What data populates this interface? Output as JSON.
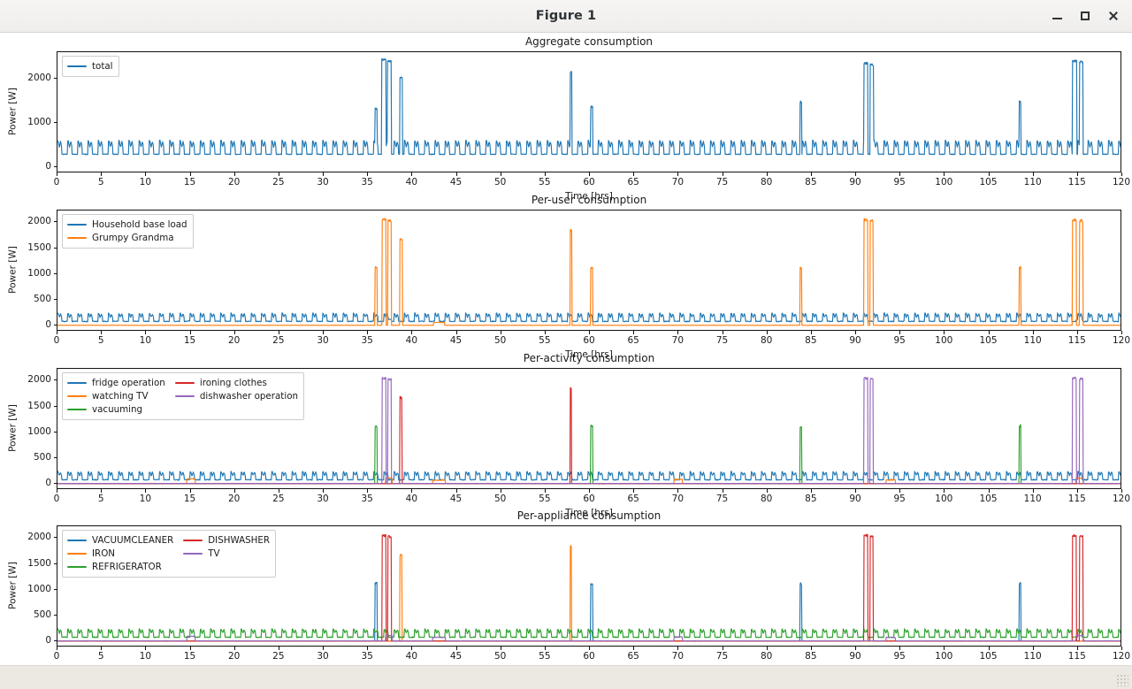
{
  "window": {
    "title": "Figure 1",
    "buttons": [
      {
        "name": "minimize-button",
        "label": "–"
      },
      {
        "name": "maximize-button",
        "label": "□"
      },
      {
        "name": "close-button",
        "label": "✕"
      }
    ]
  },
  "palette": {
    "blue": "#1f77b4",
    "orange": "#ff7f0e",
    "green": "#2ca02c",
    "red": "#d62728",
    "purple": "#9467bd"
  },
  "chart_data": [
    {
      "type": "line",
      "title": "Aggregate consumption",
      "xlabel": "Time [hrs]",
      "ylabel": "Power [W]",
      "xlim": [
        0,
        120
      ],
      "ylim": [
        -130,
        2600
      ],
      "xticks": [
        0,
        5,
        10,
        15,
        20,
        25,
        30,
        35,
        40,
        45,
        50,
        55,
        60,
        65,
        70,
        75,
        80,
        85,
        90,
        95,
        100,
        105,
        110,
        115,
        120
      ],
      "yticks": [
        0,
        1000,
        2000
      ],
      "grid": false,
      "legend_position": "upper left",
      "series": [
        {
          "name": "total",
          "color": "#1f77b4",
          "baseline": 180,
          "fridge_cycle_hours": 1.15,
          "fridge_peak": 400,
          "events": [
            {
              "x": 35.8,
              "w": 0.22,
              "y": 1320
            },
            {
              "x": 36.55,
              "w": 0.45,
              "y": 2430
            },
            {
              "x": 37.2,
              "w": 0.38,
              "y": 2400
            },
            {
              "x": 38.6,
              "w": 0.25,
              "y": 2020
            },
            {
              "x": 57.8,
              "w": 0.14,
              "y": 2160
            },
            {
              "x": 60.1,
              "w": 0.2,
              "y": 1370
            },
            {
              "x": 83.7,
              "w": 0.15,
              "y": 1480
            },
            {
              "x": 90.9,
              "w": 0.42,
              "y": 2350
            },
            {
              "x": 91.6,
              "w": 0.33,
              "y": 2320
            },
            {
              "x": 108.4,
              "w": 0.15,
              "y": 1480
            },
            {
              "x": 114.4,
              "w": 0.45,
              "y": 2400
            },
            {
              "x": 115.2,
              "w": 0.35,
              "y": 2380
            }
          ]
        }
      ]
    },
    {
      "type": "line",
      "title": "Per-user consumption",
      "xlabel": "Time [hrs]",
      "ylabel": "Power [W]",
      "xlim": [
        0,
        120
      ],
      "ylim": [
        -120,
        2230
      ],
      "xticks": [
        0,
        5,
        10,
        15,
        20,
        25,
        30,
        35,
        40,
        45,
        50,
        55,
        60,
        65,
        70,
        75,
        80,
        85,
        90,
        95,
        100,
        105,
        110,
        115,
        120
      ],
      "yticks": [
        0,
        500,
        1000,
        1500,
        2000
      ],
      "grid": false,
      "legend_position": "upper left",
      "series": [
        {
          "name": "Household base load",
          "color": "#1f77b4",
          "baseline": 20,
          "fridge_cycle_hours": 1.15,
          "fridge_peak": 200,
          "events": [
            {
              "x": 14.6,
              "w": 0.9,
              "y": 90
            },
            {
              "x": 37.0,
              "w": 0.6,
              "y": 120
            },
            {
              "x": 42.3,
              "w": 1.3,
              "y": 60
            },
            {
              "x": 69.5,
              "w": 0.8,
              "y": 80
            },
            {
              "x": 93.4,
              "w": 1.0,
              "y": 70
            },
            {
              "x": 114.8,
              "w": 0.7,
              "y": 110
            }
          ]
        },
        {
          "name": "Grumpy Grandma",
          "color": "#ff7f0e",
          "baseline": 4,
          "fridge_cycle_hours": 0,
          "fridge_peak": 0,
          "events": [
            {
              "x": 35.8,
              "w": 0.2,
              "y": 1120
            },
            {
              "x": 36.6,
              "w": 0.4,
              "y": 2050
            },
            {
              "x": 37.25,
              "w": 0.34,
              "y": 2030
            },
            {
              "x": 38.6,
              "w": 0.24,
              "y": 1670
            },
            {
              "x": 42.4,
              "w": 1.2,
              "y": 60
            },
            {
              "x": 57.8,
              "w": 0.13,
              "y": 1840
            },
            {
              "x": 60.1,
              "w": 0.2,
              "y": 1120
            },
            {
              "x": 83.7,
              "w": 0.14,
              "y": 1110
            },
            {
              "x": 90.9,
              "w": 0.4,
              "y": 2050
            },
            {
              "x": 91.6,
              "w": 0.32,
              "y": 2030
            },
            {
              "x": 108.4,
              "w": 0.14,
              "y": 1120
            },
            {
              "x": 114.4,
              "w": 0.42,
              "y": 2050
            },
            {
              "x": 115.2,
              "w": 0.33,
              "y": 2030
            }
          ]
        }
      ]
    },
    {
      "type": "line",
      "title": "Per-activity consumption",
      "xlabel": "Time [hrs]",
      "ylabel": "Power [W]",
      "xlim": [
        0,
        120
      ],
      "ylim": [
        -120,
        2230
      ],
      "xticks": [
        0,
        5,
        10,
        15,
        20,
        25,
        30,
        35,
        40,
        45,
        50,
        55,
        60,
        65,
        70,
        75,
        80,
        85,
        90,
        95,
        100,
        105,
        110,
        115,
        120
      ],
      "yticks": [
        0,
        500,
        1000,
        1500,
        2000
      ],
      "grid": false,
      "legend_position": "upper left",
      "legend_columns": 2,
      "series": [
        {
          "name": "fridge operation",
          "color": "#1f77b4",
          "baseline": 18,
          "fridge_cycle_hours": 1.15,
          "fridge_peak": 200,
          "events": []
        },
        {
          "name": "watching TV",
          "color": "#ff7f0e",
          "baseline": 4,
          "fridge_cycle_hours": 0,
          "fridge_peak": 0,
          "events": [
            {
              "x": 14.6,
              "w": 0.9,
              "y": 95
            },
            {
              "x": 37.0,
              "w": 0.7,
              "y": 110
            },
            {
              "x": 42.3,
              "w": 1.4,
              "y": 70
            },
            {
              "x": 69.5,
              "w": 0.9,
              "y": 85
            },
            {
              "x": 93.4,
              "w": 1.0,
              "y": 75
            },
            {
              "x": 114.8,
              "w": 0.8,
              "y": 110
            }
          ]
        },
        {
          "name": "vacuuming",
          "color": "#2ca02c",
          "baseline": 2,
          "fridge_cycle_hours": 0,
          "fridge_peak": 0,
          "events": [
            {
              "x": 35.8,
              "w": 0.18,
              "y": 1120
            },
            {
              "x": 60.1,
              "w": 0.18,
              "y": 1120
            },
            {
              "x": 83.7,
              "w": 0.13,
              "y": 1110
            },
            {
              "x": 108.4,
              "w": 0.13,
              "y": 1120
            }
          ]
        },
        {
          "name": "ironing clothes",
          "color": "#d62728",
          "baseline": 2,
          "fridge_cycle_hours": 0,
          "fridge_peak": 0,
          "events": [
            {
              "x": 38.6,
              "w": 0.22,
              "y": 1670
            },
            {
              "x": 57.8,
              "w": 0.12,
              "y": 1840
            }
          ]
        },
        {
          "name": "dishwasher operation",
          "color": "#9467bd",
          "baseline": 6,
          "fridge_cycle_hours": 0,
          "fridge_peak": 0,
          "events": [
            {
              "x": 36.6,
              "w": 0.4,
              "y": 2050
            },
            {
              "x": 37.25,
              "w": 0.34,
              "y": 2030
            },
            {
              "x": 90.9,
              "w": 0.4,
              "y": 2050
            },
            {
              "x": 91.6,
              "w": 0.32,
              "y": 2030
            },
            {
              "x": 114.4,
              "w": 0.42,
              "y": 2050
            },
            {
              "x": 115.2,
              "w": 0.33,
              "y": 2030
            }
          ]
        }
      ]
    },
    {
      "type": "line",
      "title": "Per-appliance consumption",
      "xlabel": "Time [hrs]",
      "ylabel": "Power [W]",
      "xlim": [
        0,
        120
      ],
      "ylim": [
        -120,
        2230
      ],
      "xticks": [
        0,
        5,
        10,
        15,
        20,
        25,
        30,
        35,
        40,
        45,
        50,
        55,
        60,
        65,
        70,
        75,
        80,
        85,
        90,
        95,
        100,
        105,
        110,
        115,
        120
      ],
      "yticks": [
        0,
        500,
        1000,
        1500,
        2000
      ],
      "grid": false,
      "legend_position": "upper left",
      "legend_columns": 2,
      "series": [
        {
          "name": "VACUUMCLEANER",
          "color": "#1f77b4",
          "baseline": 2,
          "fridge_cycle_hours": 0,
          "fridge_peak": 0,
          "events": [
            {
              "x": 35.8,
              "w": 0.18,
              "y": 1120
            },
            {
              "x": 60.1,
              "w": 0.18,
              "y": 1120
            },
            {
              "x": 83.7,
              "w": 0.13,
              "y": 1110
            },
            {
              "x": 108.4,
              "w": 0.13,
              "y": 1120
            }
          ]
        },
        {
          "name": "IRON",
          "color": "#ff7f0e",
          "baseline": 2,
          "fridge_cycle_hours": 0,
          "fridge_peak": 0,
          "events": [
            {
              "x": 38.6,
              "w": 0.22,
              "y": 1670
            },
            {
              "x": 57.8,
              "w": 0.12,
              "y": 1840
            }
          ]
        },
        {
          "name": "REFRIGERATOR",
          "color": "#2ca02c",
          "baseline": 18,
          "fridge_cycle_hours": 1.15,
          "fridge_peak": 200,
          "events": []
        },
        {
          "name": "DISHWASHER",
          "color": "#d62728",
          "baseline": 4,
          "fridge_cycle_hours": 0,
          "fridge_peak": 0,
          "events": [
            {
              "x": 36.6,
              "w": 0.4,
              "y": 2050
            },
            {
              "x": 37.25,
              "w": 0.34,
              "y": 2030
            },
            {
              "x": 90.9,
              "w": 0.4,
              "y": 2050
            },
            {
              "x": 91.6,
              "w": 0.32,
              "y": 2030
            },
            {
              "x": 114.4,
              "w": 0.42,
              "y": 2050
            },
            {
              "x": 115.2,
              "w": 0.33,
              "y": 2030
            }
          ]
        },
        {
          "name": "TV",
          "color": "#9467bd",
          "baseline": 8,
          "fridge_cycle_hours": 0,
          "fridge_peak": 0,
          "events": [
            {
              "x": 14.6,
              "w": 0.9,
              "y": 95
            },
            {
              "x": 37.0,
              "w": 0.7,
              "y": 110
            },
            {
              "x": 42.3,
              "w": 1.4,
              "y": 75
            },
            {
              "x": 69.5,
              "w": 0.9,
              "y": 85
            },
            {
              "x": 93.4,
              "w": 1.0,
              "y": 75
            },
            {
              "x": 114.8,
              "w": 0.8,
              "y": 110
            }
          ]
        }
      ]
    }
  ]
}
